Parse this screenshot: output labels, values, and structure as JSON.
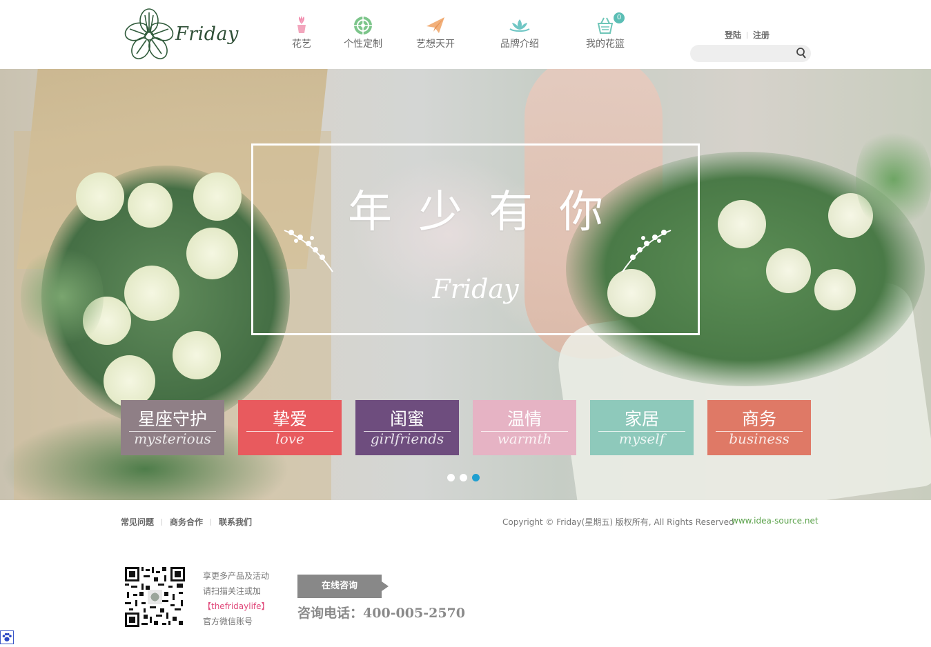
{
  "logo": {
    "text": "Friday"
  },
  "nav": [
    {
      "label": "花艺",
      "icon": "flower-pot-icon"
    },
    {
      "label": "个性定制",
      "icon": "target-icon"
    },
    {
      "label": "艺想天开",
      "icon": "paper-plane-icon"
    },
    {
      "label": "品牌介绍",
      "icon": "lotus-icon"
    },
    {
      "label": "我的花篮",
      "icon": "basket-icon",
      "badge": "0"
    }
  ],
  "auth": {
    "login": "登陆",
    "register": "注册"
  },
  "search": {
    "placeholder": "",
    "icon": "search-icon"
  },
  "banner": {
    "title": "年少有你",
    "subtitle": "Friday",
    "active_slide": 3
  },
  "categories": [
    {
      "zh": "星座守护",
      "en": "mysterious",
      "color": "#8f7f86"
    },
    {
      "zh": "挚爱",
      "en": "love",
      "color": "#e85a5e"
    },
    {
      "zh": "闺蜜",
      "en": "girlfriends",
      "color": "#6e4d7e"
    },
    {
      "zh": "温情",
      "en": "warmth",
      "color": "#e6b3c4"
    },
    {
      "zh": "家居",
      "en": "myself",
      "color": "#8ec9bb"
    },
    {
      "zh": "商务",
      "en": "business",
      "color": "#df7966"
    }
  ],
  "footer": {
    "links": [
      "常见问题",
      "商务合作",
      "联系我们"
    ],
    "copyright": "Copyright © Friday(星期五) 版权所有, All Rights Reserved",
    "site": "www.idea-source.net",
    "qr_lines": [
      "享更多产品及活动",
      "请扫描关注或加",
      "【thefridaylife】",
      "官方微信账号"
    ],
    "consult_label": "在线咨询",
    "phone": "咨询电话：400-005-2570"
  },
  "colors": {
    "accent_blue": "#1f9fd0",
    "accent_green": "#5aa24a",
    "accent_pink": "#e0487a"
  }
}
